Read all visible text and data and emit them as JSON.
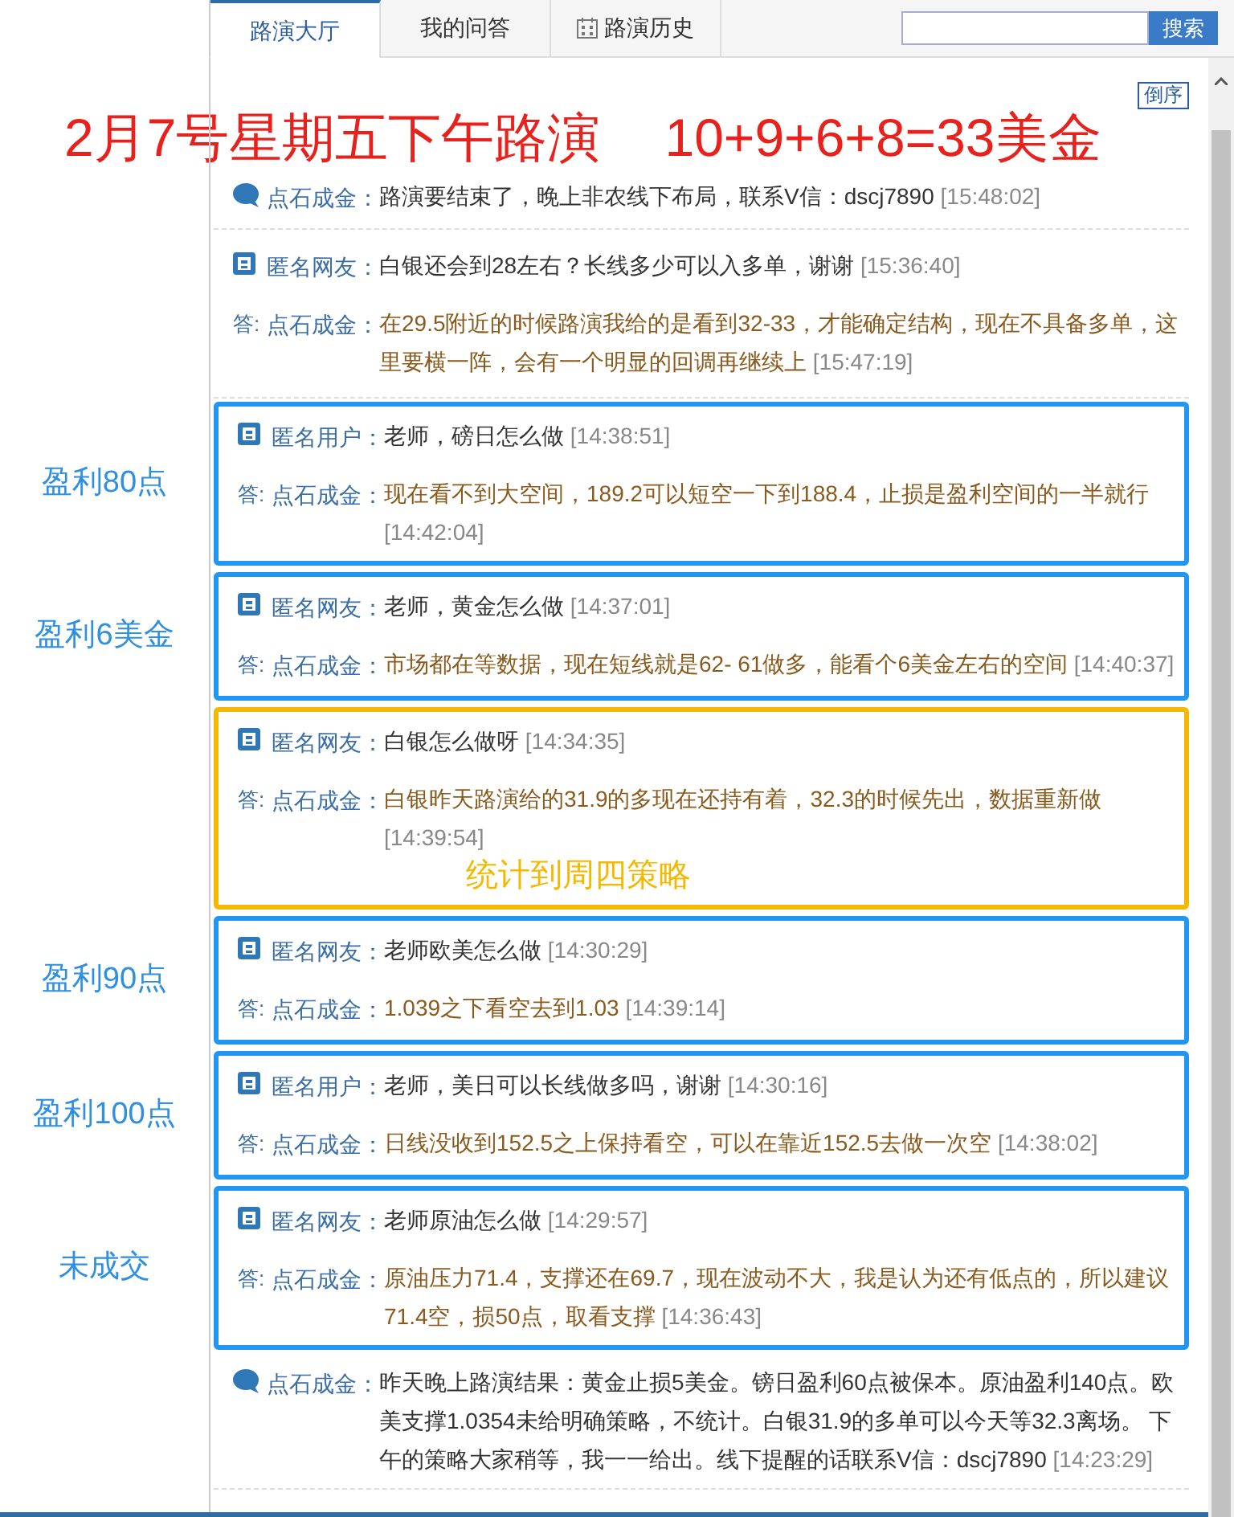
{
  "tabs": [
    {
      "label": "路演大厅",
      "selected": true
    },
    {
      "label": "我的问答",
      "selected": false
    },
    {
      "label": "路演历史",
      "selected": false
    }
  ],
  "search": {
    "button": "搜索"
  },
  "sort_button": "倒序",
  "headline": [
    "2月7号星期五下午路演",
    "10+9+6+8=33美金"
  ],
  "messages": [
    {
      "kind": "announcement",
      "author": "点石成金：",
      "text": "路演要结束了，晚上非农线下布局，联系V信：dscj7890",
      "time": "[15:48:02]"
    },
    {
      "kind": "qa",
      "question": {
        "author": "匿名网友：",
        "text": "白银还会到28左右？长线多少可以入多单，谢谢",
        "time": "[15:36:40]"
      },
      "answer": {
        "prefix": "答:",
        "author": "点石成金：",
        "text": "在29.5附近的时候路演我给的是看到32-33，才能确定结构，现在不具备多单，这里要横一阵，会有一个明显的回调再继续上",
        "time": "[15:47:19]"
      }
    },
    {
      "kind": "qa",
      "color": "#2196f3",
      "side_label": "盈利80点",
      "question": {
        "author": "匿名用户：",
        "text": "老师，磅日怎么做",
        "time": "[14:38:51]"
      },
      "answer": {
        "prefix": "答:",
        "author": "点石成金：",
        "text": "现在看不到大空间，189.2可以短空一下到188.4，止损是盈利空间的一半就行",
        "time": "[14:42:04]"
      }
    },
    {
      "kind": "qa",
      "color": "#2196f3",
      "side_label": "盈利6美金",
      "question": {
        "author": "匿名网友：",
        "text": "老师，黄金怎么做",
        "time": "[14:37:01]"
      },
      "answer": {
        "prefix": "答:",
        "author": "点石成金：",
        "text": "市场都在等数据，现在短线就是62- 61做多，能看个6美金左右的空间",
        "time": "[14:40:37]"
      }
    },
    {
      "kind": "qa",
      "color": "#f5b800",
      "note": "统计到周四策略",
      "question": {
        "author": "匿名网友：",
        "text": "白银怎么做呀",
        "time": "[14:34:35]"
      },
      "answer": {
        "prefix": "答:",
        "author": "点石成金：",
        "text": "白银昨天路演给的31.9的多现在还持有着，32.3的时候先出，数据重新做",
        "time": "[14:39:54]"
      }
    },
    {
      "kind": "qa",
      "color": "#2196f3",
      "side_label": "盈利90点",
      "question": {
        "author": "匿名网友：",
        "text": "老师欧美怎么做",
        "time": "[14:30:29]"
      },
      "answer": {
        "prefix": "答:",
        "author": "点石成金：",
        "text": "1.039之下看空去到1.03",
        "time": "[14:39:14]"
      }
    },
    {
      "kind": "qa",
      "color": "#2196f3",
      "side_label": "盈利100点",
      "question": {
        "author": "匿名用户：",
        "text": "老师，美日可以长线做多吗，谢谢",
        "time": "[14:30:16]"
      },
      "answer": {
        "prefix": "答:",
        "author": "点石成金：",
        "text": "日线没收到152.5之上保持看空，可以在靠近152.5去做一次空",
        "time": "[14:38:02]"
      }
    },
    {
      "kind": "qa",
      "color": "#2196f3",
      "side_label": "未成交",
      "question": {
        "author": "匿名网友：",
        "text": "老师原油怎么做",
        "time": "[14:29:57]"
      },
      "answer": {
        "prefix": "答:",
        "author": "点石成金：",
        "text": "原油压力71.4，支撑还在69.7，现在波动不大，我是认为还有低点的，所以建议71.4空，损50点，取看支撑",
        "time": "[14:36:43]"
      }
    },
    {
      "kind": "announcement",
      "author": "点石成金：",
      "text": "昨天晚上路演结果：黄金止损5美金。镑日盈利60点被保本。原油盈利140点。欧美支撑1.0354未给明确策略，不统计。白银31.9的多单可以今天等32.3离场。 下午的策略大家稍等，我一一给出。线下提醒的话联系V信：dscj7890",
      "time": "[14:23:29]"
    }
  ]
}
